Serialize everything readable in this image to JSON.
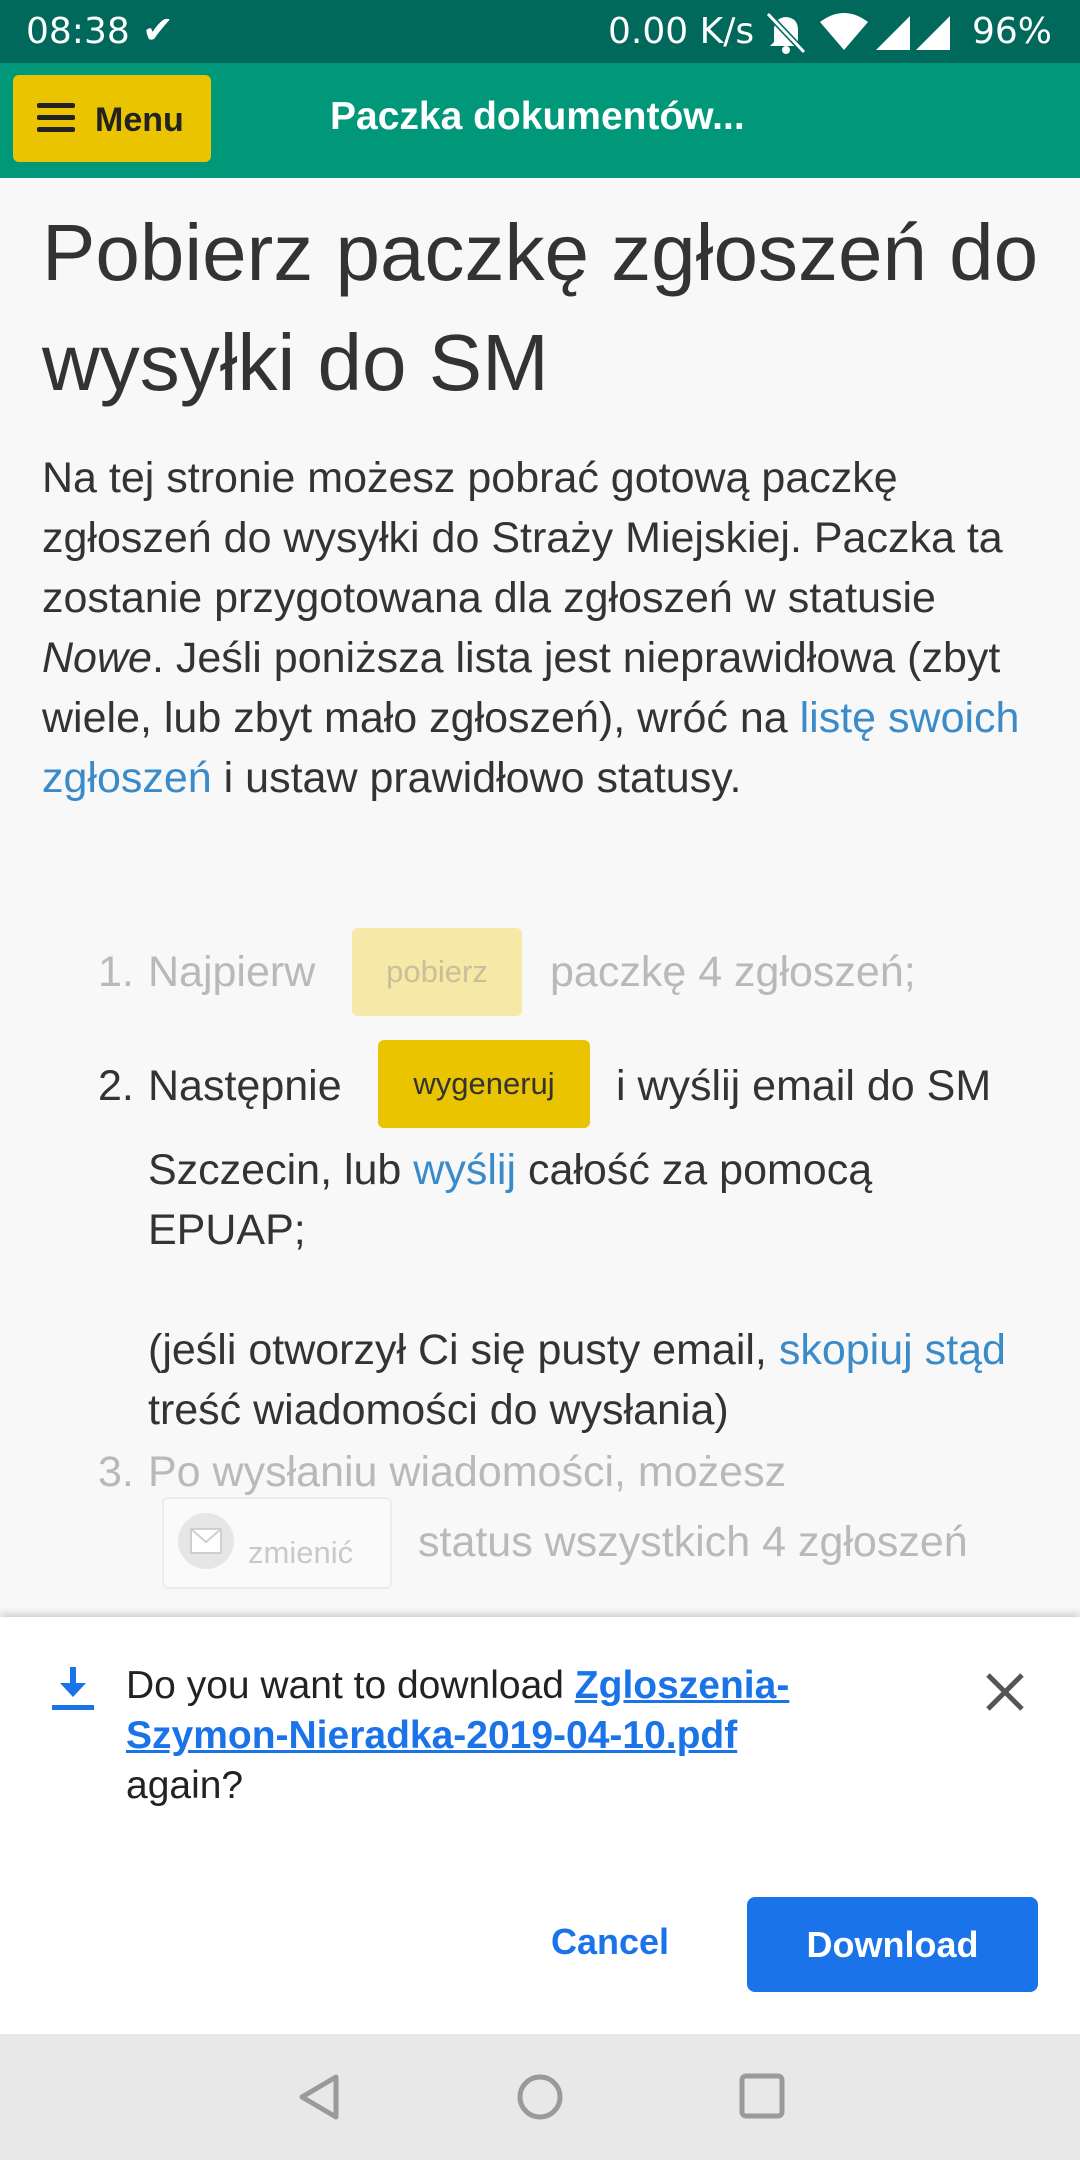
{
  "status_bar": {
    "time": "08:38",
    "speed": "0.00 K/s",
    "battery": "96%"
  },
  "header": {
    "menu_label": "Menu",
    "title": "Paczka dokumentów..."
  },
  "page": {
    "heading": "Pobierz paczkę zgłoszeń do wysyłki do SM",
    "intro_part1": "Na tej stronie możesz pobrać gotową paczkę zgłoszeń do wysyłki do Straży Miejskiej. Paczka ta zostanie przygotowana dla zgłoszeń w statusie ",
    "intro_status": "Nowe",
    "intro_part2": ". Jeśli poniższa lista jest nieprawidłowa (zbyt wiele, lub zbyt mało zgłoszeń), wróć na ",
    "intro_link": "listę swoich zgłoszeń",
    "intro_part3": " i ustaw prawidłowo statusy."
  },
  "steps": {
    "s1_num": "1.",
    "s1_before": "Najpierw",
    "s1_button": "pobierz",
    "s1_after": "paczkę 4 zgłoszeń;",
    "s2_num": "2.",
    "s2_before": "Następnie",
    "s2_button": "wygeneruj",
    "s2_after": "i wyślij email do SM",
    "s2_line2_a": "Szczecin, lub ",
    "s2_line2_link": "wyślij",
    "s2_line2_b": " całość za pomocą",
    "s2_line3": "EPUAP;",
    "s2_note_a": "(jeśli otworzył Ci się pusty email, ",
    "s2_note_link": "skopiuj stąd",
    "s2_note_b": " treść wiadomości do wysłania)",
    "s3_num": "3.",
    "s3_text": "Po wysłaniu wiadomości, możesz",
    "s3_button": "zmienić",
    "s3_after": "status wszystkich 4 zgłoszeń"
  },
  "download_sheet": {
    "prefix": "Do you want to download ",
    "filename": "Zgloszenia-Szymon-Nieradka-2019-04-10.pdf",
    "suffix": " again?",
    "cancel_label": "Cancel",
    "download_label": "Download"
  },
  "colors": {
    "status_bar": "#00695c",
    "header": "#009879",
    "menu_button": "#eac400",
    "link": "#3a8bc8",
    "primary": "#1a73e8"
  },
  "icons": [
    "check-icon",
    "mute-icon",
    "wifi-icon",
    "signal-icon",
    "burger-icon",
    "envelope-icon",
    "download-icon",
    "close-icon",
    "back-icon",
    "home-icon",
    "recents-icon"
  ]
}
